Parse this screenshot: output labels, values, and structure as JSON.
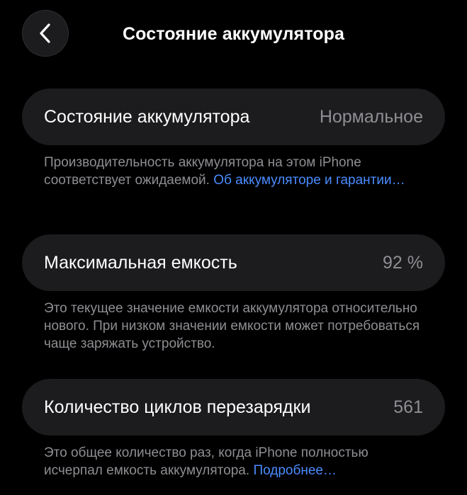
{
  "nav": {
    "title": "Состояние аккумулятора",
    "back_icon": "chevron-left-icon"
  },
  "health": {
    "label": "Состояние аккумулятора",
    "value": "Нормальное",
    "note_text": "Производительность аккумулятора на этом iPhone соответствует ожидаемой. ",
    "note_link": "Об аккумуляторе и гарантии…"
  },
  "capacity": {
    "label": "Максимальная емкость",
    "value": "92 %",
    "note_text": "Это текущее значение емкости аккумулятора относительно нового. При низком значении емкости может потребоваться чаще заряжать устройство."
  },
  "cycles": {
    "label": "Количество циклов перезарядки",
    "value": "561",
    "note_text": "Это общее количество раз, когда iPhone полностью исчерпал емкость аккумулятора. ",
    "note_link": "Подробнее…"
  },
  "colors": {
    "background": "#000000",
    "card": "#1c1c1e",
    "secondary_text": "#8e8e93",
    "link": "#4a8cff"
  }
}
